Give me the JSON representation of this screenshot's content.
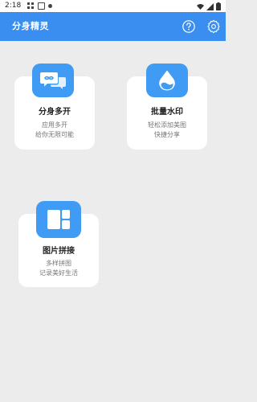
{
  "status_bar": {
    "time": "2:18"
  },
  "header": {
    "title": "分身精灵",
    "help_icon": "help-circle-icon",
    "settings_icon": "gear-icon"
  },
  "cards": [
    {
      "title": "分身多开",
      "desc_line1": "应用多开",
      "desc_line2": "给你无限可能",
      "icon": "chat-bubbles-icon"
    },
    {
      "title": "批量水印",
      "desc_line1": "轻松添加美图",
      "desc_line2": "快捷分享",
      "icon": "water-drop-icon"
    },
    {
      "title": "图片拼接",
      "desc_line1": "多样拼图",
      "desc_line2": "记录美好生活",
      "icon": "collage-icon"
    }
  ],
  "colors": {
    "accent": "#3a8ef0",
    "icon_bg": "#3f9bf3",
    "page_bg": "#ececec"
  }
}
